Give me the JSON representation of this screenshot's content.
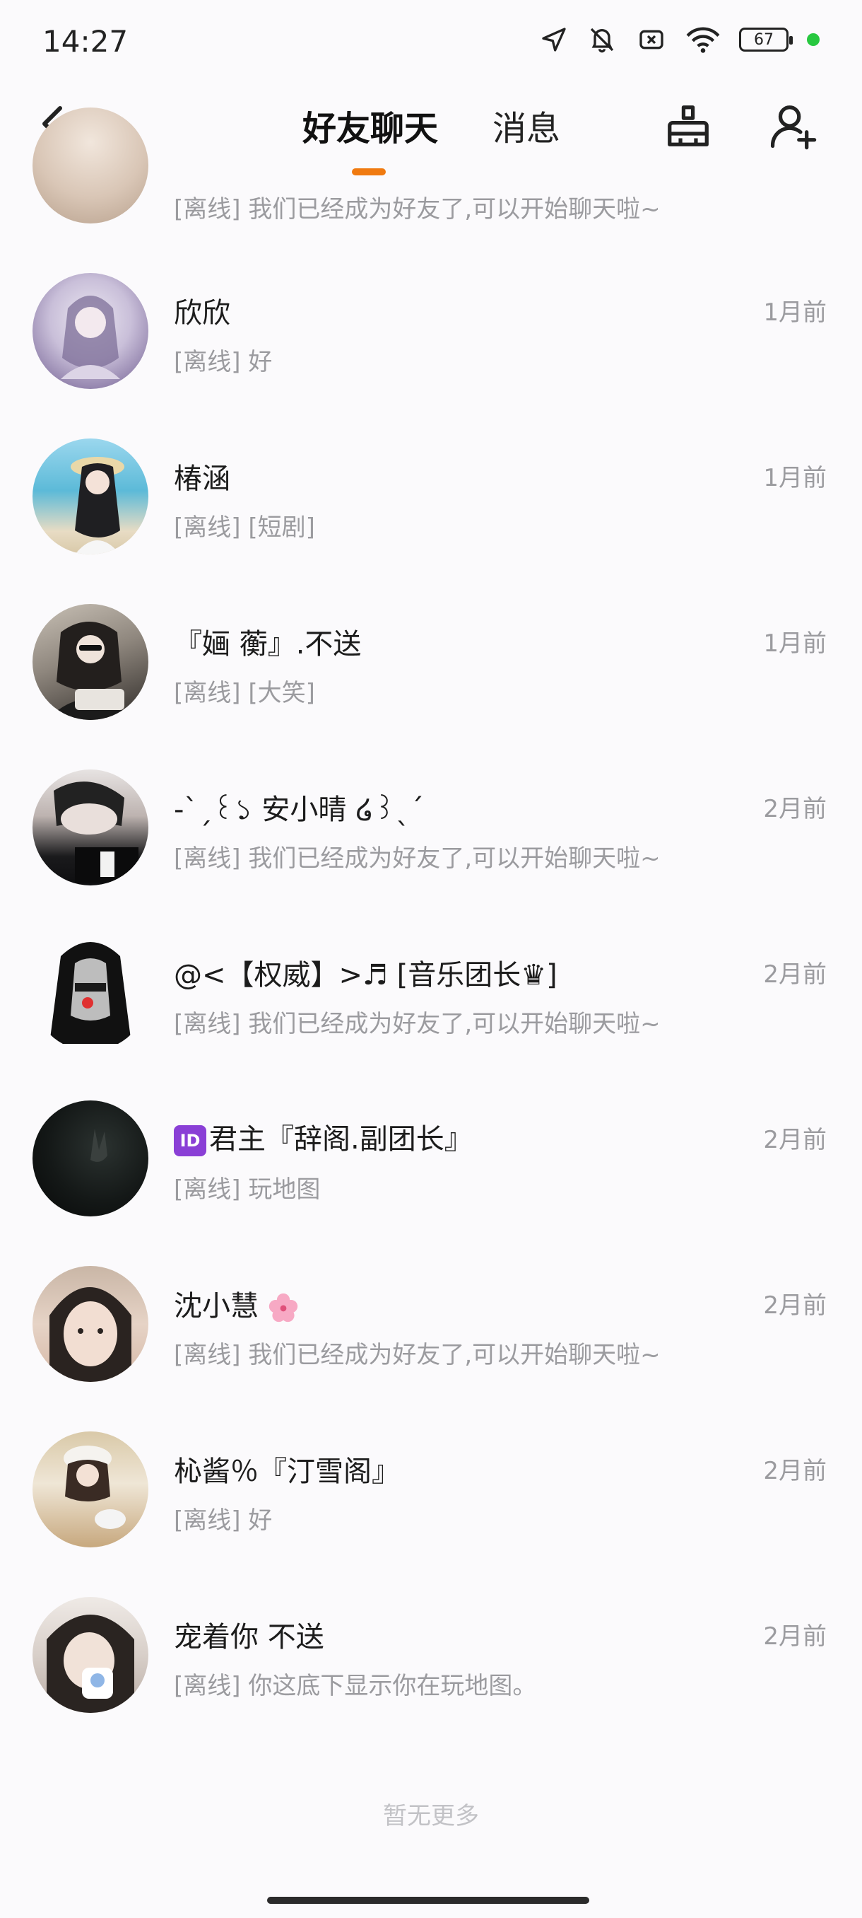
{
  "status_bar": {
    "time": "14:27",
    "battery": "67"
  },
  "header": {
    "tabs": [
      {
        "label": "好友聊天",
        "active": true
      },
      {
        "label": "消息",
        "active": false
      }
    ],
    "accent_color": "#f07a10"
  },
  "chats": [
    {
      "name": "",
      "preview": "[离线] 我们已经成为好友了,可以开始聊天啦~",
      "time": ""
    },
    {
      "name": "欣欣",
      "preview": "[离线] 好",
      "time": "1月前"
    },
    {
      "name": "椿涵",
      "preview": "[离线] [短剧]",
      "time": "1月前"
    },
    {
      "name": "『婳 蘅』.不送",
      "preview": "[离线] [大笑]",
      "time": "1月前"
    },
    {
      "name": "-ˋˏ꒰১ 安小晴 ໒꒱ˎˊ",
      "preview": "[离线] 我们已经成为好友了,可以开始聊天啦~",
      "time": "2月前"
    },
    {
      "name": "@<【权威】>♬ [音乐团长♛]",
      "preview": "[离线] 我们已经成为好友了,可以开始聊天啦~",
      "time": "2月前"
    },
    {
      "name": "君主『辞阁.副团长』",
      "badge": "ID",
      "preview": "[离线] 玩地图",
      "time": "2月前"
    },
    {
      "name": "沈小慧",
      "preview": "[离线] 我们已经成为好友了,可以开始聊天啦~",
      "time": "2月前"
    },
    {
      "name": "杺酱％『汀雪阁』",
      "preview": "[离线] 好",
      "time": "2月前"
    },
    {
      "name": "宠着你 不送",
      "preview": "[离线] 你这底下显示你在玩地图。",
      "time": "2月前"
    }
  ],
  "footer": {
    "no_more": "暂无更多"
  }
}
